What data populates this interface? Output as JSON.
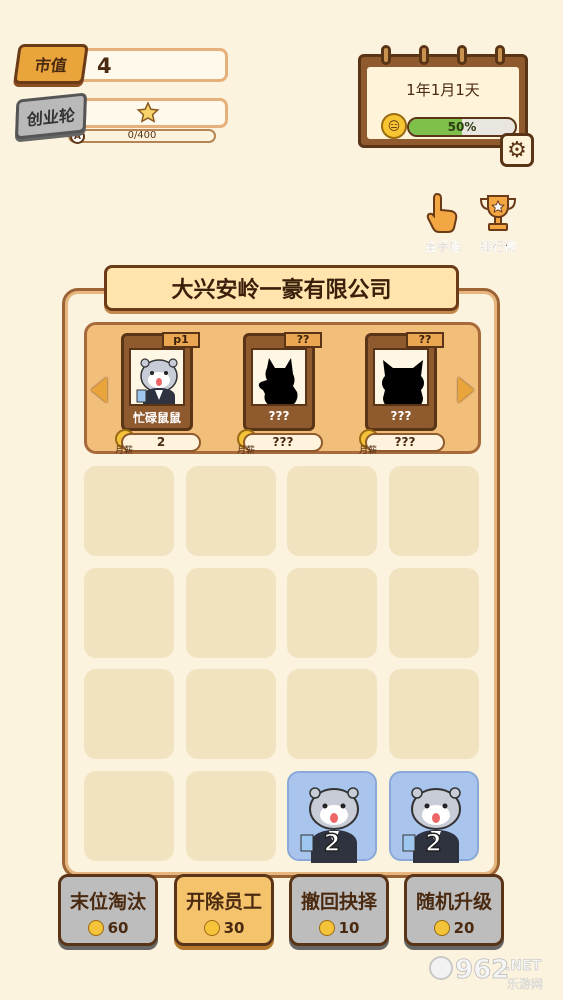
{
  "stats": {
    "market_label": "市值",
    "market_value": "4",
    "round_label": "创业轮",
    "round_badge": "A",
    "round_progress": "0/400"
  },
  "calendar": {
    "date": "1年1月1天",
    "percent_text": "50%",
    "percent": 50
  },
  "shortcuts": [
    {
      "label": "金手指",
      "icon": "pointing-hand-icon"
    },
    {
      "label": "排行榜",
      "icon": "trophy-icon"
    }
  ],
  "company": {
    "name": "大兴安岭一豪有限公司"
  },
  "characters": [
    {
      "tag": "p1",
      "name": "忙碌鼠鼠",
      "salary": "2",
      "salary_label": "月薪",
      "locked": false
    },
    {
      "tag": "??",
      "name": "???",
      "salary": "???",
      "salary_label": "月薪",
      "locked": true
    },
    {
      "tag": "??",
      "name": "???",
      "salary": "???",
      "salary_label": "月薪",
      "locked": true
    }
  ],
  "grid": {
    "rows": 4,
    "cols": 4,
    "employees": [
      {
        "row": 3,
        "col": 2,
        "level": "2"
      },
      {
        "row": 3,
        "col": 3,
        "level": "2"
      }
    ]
  },
  "actions": [
    {
      "label": "末位淘汰",
      "cost": "60",
      "style": "grey"
    },
    {
      "label": "开除员工",
      "cost": "30",
      "style": "gold"
    },
    {
      "label": "撤回抉择",
      "cost": "10",
      "style": "grey"
    },
    {
      "label": "随机升级",
      "cost": "20",
      "style": "grey"
    }
  ],
  "watermark": {
    "number": "962",
    "suffix": ".NET",
    "subtitle": "乐游网"
  }
}
